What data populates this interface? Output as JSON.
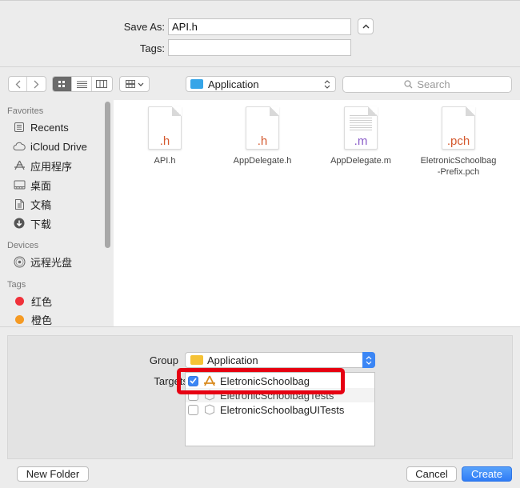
{
  "form": {
    "save_as_label": "Save As:",
    "save_as_value": "API.h",
    "tags_label": "Tags:",
    "tags_value": "",
    "collapse_glyph": "^"
  },
  "toolbar": {
    "back_glyph": "‹",
    "forward_glyph": "›",
    "location": "Application",
    "search_placeholder": "Search"
  },
  "sidebar": {
    "favorites_header": "Favorites",
    "favorites": [
      {
        "label": "Recents",
        "icon": "recents-icon"
      },
      {
        "label": "iCloud Drive",
        "icon": "cloud-icon"
      },
      {
        "label": "应用程序",
        "icon": "applications-icon"
      },
      {
        "label": "桌面",
        "icon": "desktop-icon"
      },
      {
        "label": "文稿",
        "icon": "documents-icon"
      },
      {
        "label": "下载",
        "icon": "downloads-icon"
      }
    ],
    "devices_header": "Devices",
    "devices": [
      {
        "label": "远程光盘",
        "icon": "disc-icon"
      }
    ],
    "tags_header": "Tags",
    "tags": [
      {
        "label": "红色",
        "color": "#f0313a"
      },
      {
        "label": "橙色",
        "color": "#f59a23"
      }
    ]
  },
  "files": [
    {
      "name": "API.h",
      "ext": ".h",
      "ext_color": "#d4592e",
      "name_line2": ""
    },
    {
      "name": "AppDelegate.h",
      "ext": ".h",
      "ext_color": "#d4592e",
      "name_line2": ""
    },
    {
      "name": "AppDelegate.m",
      "ext": ".m",
      "ext_color": "#8a5cc8",
      "name_line2": ""
    },
    {
      "name": "EletronicSchoolbag",
      "ext": ".pch",
      "ext_color": "#d4592e",
      "name_line2": "-Prefix.pch"
    }
  ],
  "options": {
    "group_label": "Group",
    "group_value": "Application",
    "targets_label": "Targets",
    "targets": [
      {
        "label": "EletronicSchoolbag",
        "checked": true
      },
      {
        "label": "EletronicSchoolbagTests",
        "checked": false
      },
      {
        "label": "EletronicSchoolbagUITests",
        "checked": false
      }
    ]
  },
  "buttons": {
    "new_folder": "New Folder",
    "cancel": "Cancel",
    "create": "Create"
  },
  "colors": {
    "accent": "#3b86f5",
    "highlight_box": "#e60012",
    "folder_blue": "#36a5e8",
    "folder_yellow": "#f5c236"
  }
}
